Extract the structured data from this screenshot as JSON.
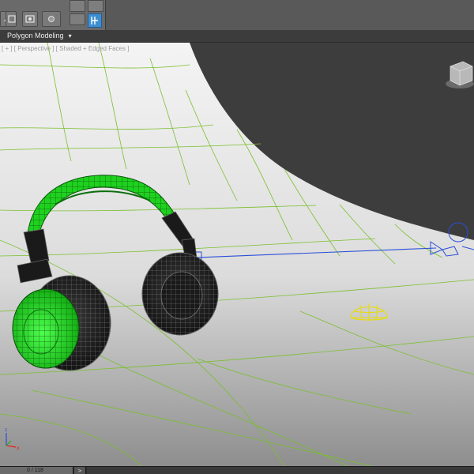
{
  "ribbon": {
    "tab_label": "Polygon Modeling",
    "tab_arrow": "▾"
  },
  "viewport": {
    "label": "[ + ] [ Perspective ] [ Shaded + Edged Faces ]",
    "colors": {
      "wire": "#7abf2f",
      "accent_green": "#1fd11f",
      "selection_yellow": "#e8dc00",
      "light_blue": "#2a4fd8",
      "backdrop": "#f2f2f2",
      "background": "#3d3d3d"
    }
  },
  "timeline": {
    "frame_label": "0 / 118",
    "next_label": ">"
  },
  "icons": [
    "toolbar-icon",
    "layer-icon",
    "render-icon",
    "settings-icon",
    "snap-icon",
    "viewcube-icon",
    "axis-tripod-icon"
  ]
}
